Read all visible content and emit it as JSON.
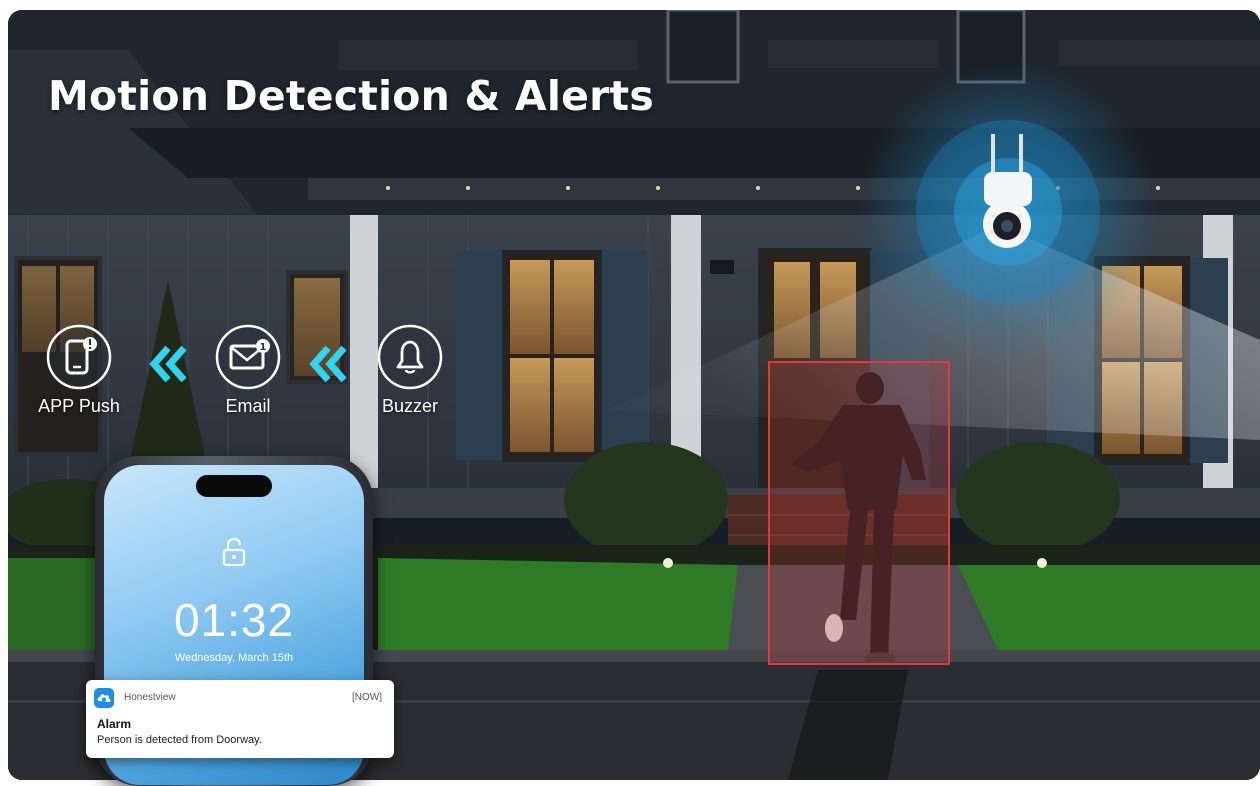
{
  "title": "Motion Detection & Alerts",
  "alerts": [
    {
      "label": "APP Push",
      "icon": "phone-alert-icon"
    },
    {
      "label": "Email",
      "icon": "mail-alert-icon"
    },
    {
      "label": "Buzzer",
      "icon": "bell-icon"
    }
  ],
  "phone": {
    "time": "01:32",
    "date": "Wednesday, March 15th",
    "notification": {
      "app": "Honestview",
      "time": "[NOW]",
      "title": "Alarm",
      "body": "Person is detected from Doorway."
    }
  },
  "colors": {
    "accent_cyan": "#2fd6ee",
    "detection_red": "#e23a3a",
    "night_sky": "#12161d",
    "lawn_green": "#2e7a27"
  }
}
